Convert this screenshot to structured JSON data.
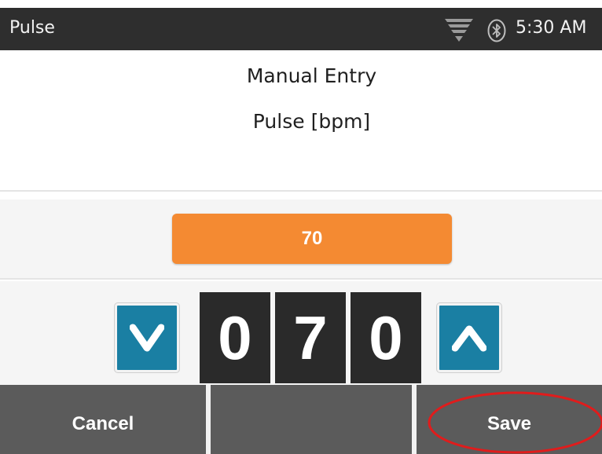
{
  "statusbar": {
    "title": "Pulse",
    "signal_icon": "signal-strength-icon",
    "bluetooth_icon": "bluetooth-icon",
    "time": "5:30 AM"
  },
  "heading": {
    "title": "Manual Entry",
    "subtitle": "Pulse [bpm]"
  },
  "value": {
    "display": "70"
  },
  "stepper": {
    "digits": [
      "0",
      "7",
      "0"
    ],
    "decrement_icon": "chevron-down-icon",
    "increment_icon": "chevron-up-icon"
  },
  "actions": {
    "cancel_label": "Cancel",
    "middle_label": "",
    "save_label": "Save"
  },
  "colors": {
    "status_bar": "#2e2e2e",
    "value_box": "#f48a32",
    "stepper_button": "#1a7fa3",
    "digit_background": "#2a2a2a",
    "action_bar": "#5b5b5b",
    "highlight_ring": "#e01c1c"
  }
}
